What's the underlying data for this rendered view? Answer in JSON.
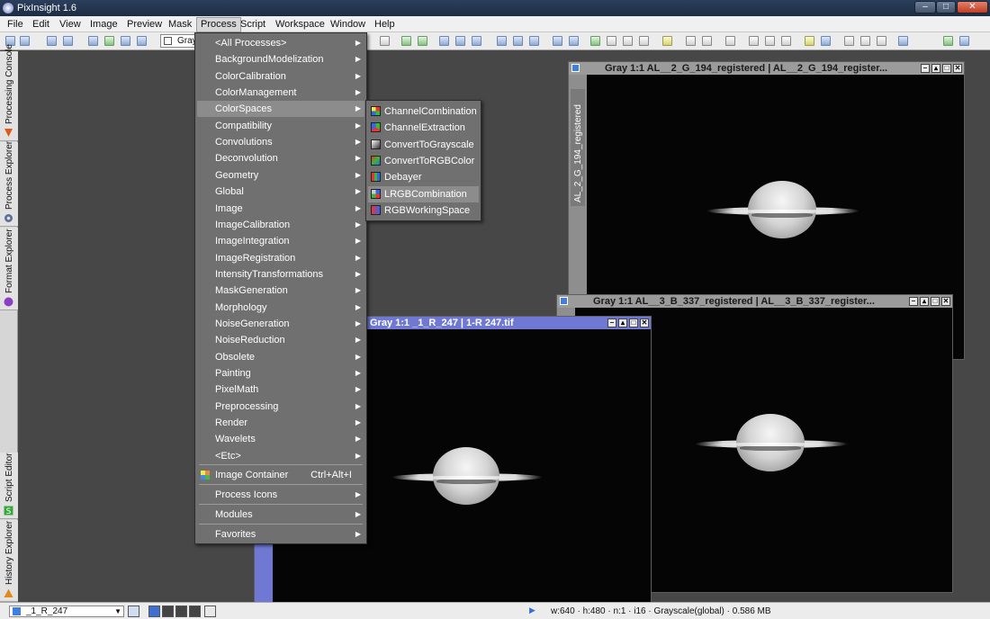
{
  "app": {
    "title": "PixInsight 1.6"
  },
  "menubar": [
    "File",
    "Edit",
    "View",
    "Image",
    "Preview",
    "Mask",
    "Process",
    "Script",
    "Workspace",
    "Window",
    "Help"
  ],
  "toolbar": {
    "combo_label": "Gray"
  },
  "left_dock": {
    "tabs": [
      "Processing Console",
      "Process Explorer",
      "Format Explorer",
      "Script Editor",
      "History Explorer"
    ]
  },
  "process_menu": {
    "items": [
      "<All Processes>",
      "BackgroundModelization",
      "ColorCalibration",
      "ColorManagement",
      "ColorSpaces",
      "Compatibility",
      "Convolutions",
      "Deconvolution",
      "Geometry",
      "Global",
      "Image",
      "ImageCalibration",
      "ImageIntegration",
      "ImageRegistration",
      "IntensityTransformations",
      "MaskGeneration",
      "Morphology",
      "NoiseGeneration",
      "NoiseReduction",
      "Obsolete",
      "Painting",
      "PixelMath",
      "Preprocessing",
      "Render",
      "Wavelets",
      "<Etc>"
    ],
    "highlighted": "ColorSpaces",
    "image_container": {
      "label": "Image Container",
      "shortcut": "Ctrl+Alt+I"
    },
    "process_icons": "Process Icons",
    "modules": "Modules",
    "favorites": "Favorites"
  },
  "colorspaces_menu": {
    "items": [
      "ChannelCombination",
      "ChannelExtraction",
      "ConvertToGrayscale",
      "ConvertToRGBColor",
      "Debayer",
      "LRGBCombination",
      "RGBWorkingSpace"
    ],
    "highlighted": "LRGBCombination"
  },
  "windows": {
    "green": {
      "title": "Gray 1:1 AL__2_G_194_registered | AL__2_G_194_register...",
      "side_label": "AL_2_G_194_registered"
    },
    "blue": {
      "title": "Gray 1:1 AL__3_B_337_registered | AL__3_B_337_register..."
    },
    "red": {
      "title": "Gray 1:1 _1_R_247 | 1-R 247.tif"
    }
  },
  "statusbar": {
    "view": "_1_R_247",
    "info": "w:640 · h:480 · n:1 · i16 · Grayscale(global) · 0.586 MB"
  }
}
